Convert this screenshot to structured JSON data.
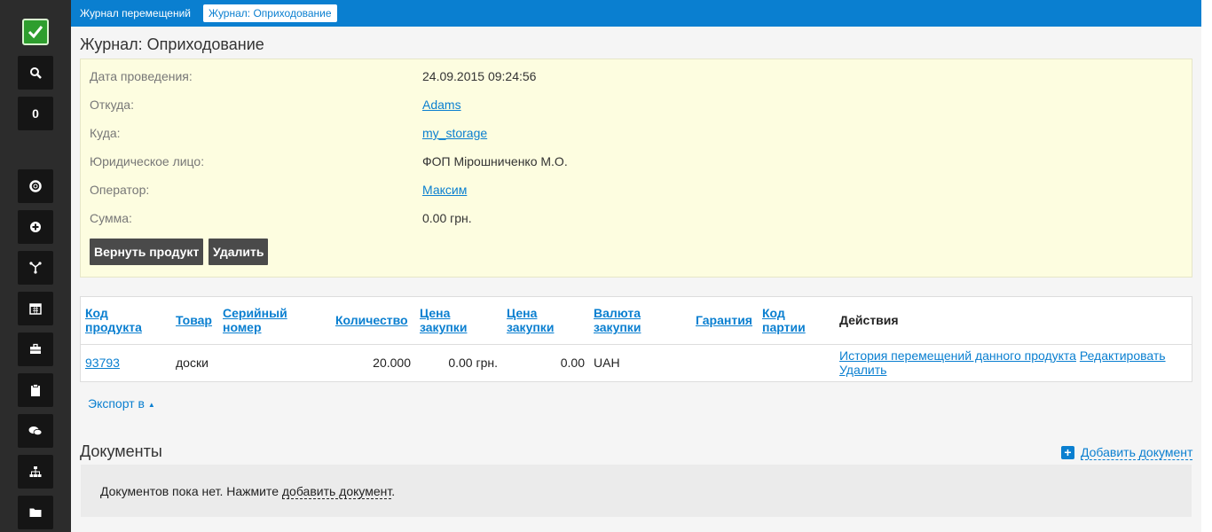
{
  "colors": {
    "accent": "#0a7fd0",
    "sidebar": "#2c2c2c",
    "panel": "#fdfde0",
    "success": "#2e9e2e"
  },
  "sidebar": {
    "counter": "0",
    "icons": [
      "search-icon",
      "lifebuoy-icon",
      "plus-circle-icon",
      "fork-icon",
      "calendar-icon",
      "briefcase-icon",
      "clipboard-icon",
      "chat-icon",
      "sitemap-icon",
      "folder-icon"
    ]
  },
  "breadcrumbs": {
    "item1": "Журнал перемещений",
    "item2": "Журнал: Оприходование"
  },
  "page": {
    "title": "Журнал: Оприходование"
  },
  "info": {
    "date_label": "Дата проведения:",
    "date_value": "24.09.2015 09:24:56",
    "from_label": "Откуда:",
    "from_value": "Adams",
    "to_label": "Куда:",
    "to_value": "my_storage",
    "entity_label": "Юридическое лицо:",
    "entity_value": "ФОП Мірошниченко М.О.",
    "operator_label": "Оператор:",
    "operator_value": "Максим",
    "sum_label": "Сумма:",
    "sum_value": "0.00 грн.",
    "return_button": "Вернуть продукт",
    "delete_button": "Удалить"
  },
  "table": {
    "headers": {
      "code_1": "Код",
      "code_2": "продукта",
      "product": "Товар",
      "serial_1": "Серийный",
      "serial_2": "номер",
      "quantity": "Количество",
      "price1_1": "Цена",
      "price1_2": "закупки",
      "price2_1": "Цена",
      "price2_2": "закупки",
      "currency_1": "Валюта",
      "currency_2": "закупки",
      "warranty": "Гарантия",
      "batch_1": "Код",
      "batch_2": "партии",
      "actions": "Действия"
    },
    "row": {
      "code": "93793",
      "product": "доски",
      "serial": "",
      "quantity": "20.000",
      "price1": "0.00 грн.",
      "price2": "0.00",
      "currency": "UAH",
      "warranty": "",
      "batch": "",
      "action_history": "История перемещений данного продукта",
      "action_edit": "Редактировать",
      "action_delete": "Удалить"
    }
  },
  "export": {
    "label": "Экспорт в"
  },
  "documents": {
    "title": "Документы",
    "add_label": "Добавить документ",
    "empty_text": "Документов пока нет. Нажмите",
    "empty_link": "добавить документ",
    "empty_end": "."
  }
}
